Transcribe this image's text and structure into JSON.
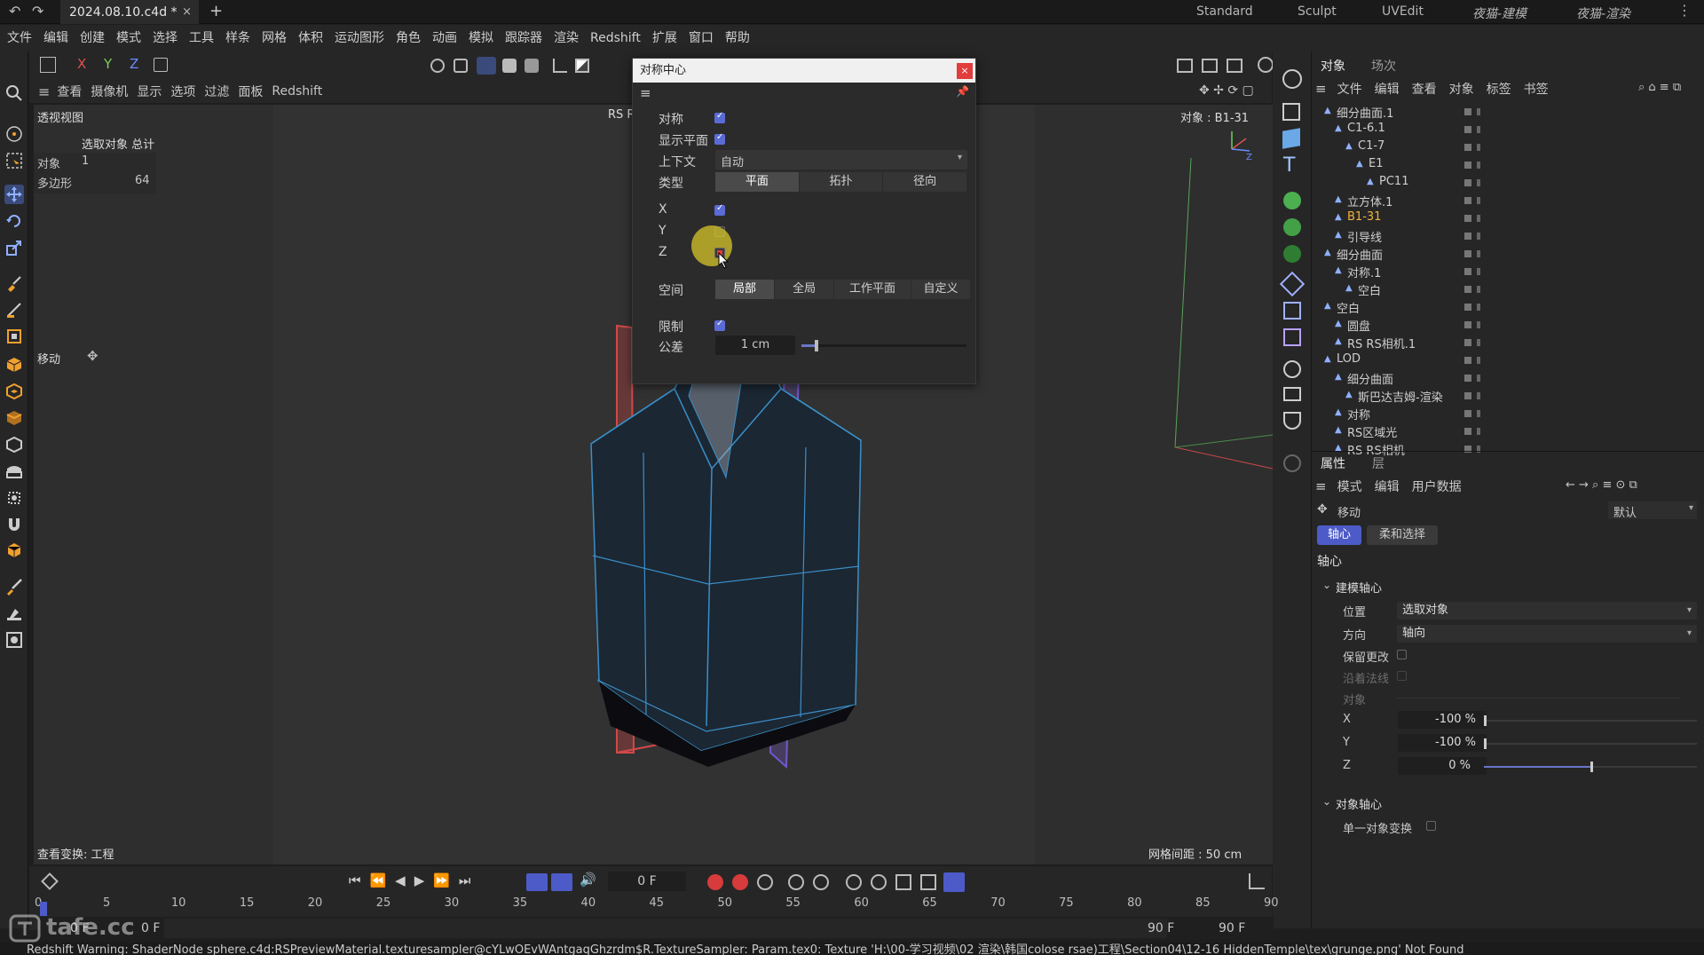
{
  "titlebar": {
    "file_tab": "2024.08.10.c4d *",
    "close": "×",
    "new_tab": "+",
    "workspaces": [
      "Standard",
      "Sculpt",
      "UVEdit",
      "夜猫-建模",
      "夜猫-渲染"
    ]
  },
  "menubar": [
    "文件",
    "编辑",
    "创建",
    "模式",
    "选择",
    "工具",
    "样条",
    "网格",
    "体积",
    "运动图形",
    "角色",
    "动画",
    "模拟",
    "跟踪器",
    "渲染",
    "Redshift",
    "扩展",
    "窗口",
    "帮助"
  ],
  "viewport": {
    "menu": [
      "查看",
      "摄像机",
      "显示",
      "选项",
      "过滤",
      "面板",
      "Redshift"
    ],
    "name": "透视视图",
    "stats_header": "选取对象 总计",
    "stats": [
      {
        "label": "对象",
        "value": "1"
      },
      {
        "label": "多边形",
        "value": "64"
      }
    ],
    "tool_label": "移动",
    "rs_label": "RS R",
    "object_label": "对象 : B1-31",
    "view_transform": "查看变换: 工程",
    "grid_spacing": "网格间距 : 50 cm"
  },
  "dialog": {
    "title": "对称中心",
    "close": "×",
    "symmetry_label": "对称",
    "show_plane_label": "显示平面",
    "context_label": "上下文",
    "context_value": "自动",
    "type_label": "类型",
    "type_options": [
      "平面",
      "拓扑",
      "径向"
    ],
    "x_label": "X",
    "y_label": "Y",
    "z_label": "Z",
    "space_label": "空间",
    "space_options": [
      "局部",
      "全局",
      "工作平面",
      "自定义"
    ],
    "limit_label": "限制",
    "tolerance_label": "公差",
    "tolerance_value": "1 cm",
    "tolerance_fraction": 0.08
  },
  "objects_panel": {
    "tabs": [
      "对象",
      "场次"
    ],
    "menu": [
      "文件",
      "编辑",
      "查看",
      "对象",
      "标签",
      "书签"
    ],
    "rows": [
      {
        "name": "细分曲面.1",
        "indent": 0
      },
      {
        "name": "C1-6.1",
        "indent": 1
      },
      {
        "name": "C1-7",
        "indent": 2
      },
      {
        "name": "E1",
        "indent": 3
      },
      {
        "name": "PC11",
        "indent": 4
      },
      {
        "name": "立方体.1",
        "indent": 1
      },
      {
        "name": "B1-31",
        "indent": 1,
        "selected": true
      },
      {
        "name": "引导线",
        "indent": 1
      },
      {
        "name": "细分曲面",
        "indent": 0
      },
      {
        "name": "对称.1",
        "indent": 1
      },
      {
        "name": "空白",
        "indent": 2
      },
      {
        "name": "空白",
        "indent": 0
      },
      {
        "name": "圆盘",
        "indent": 1
      },
      {
        "name": "RS RS相机.1",
        "indent": 1
      },
      {
        "name": "LOD",
        "indent": 0
      },
      {
        "name": "细分曲面",
        "indent": 1
      },
      {
        "name": "斯巴达吉姆-渲染",
        "indent": 2
      },
      {
        "name": "对称",
        "indent": 1
      },
      {
        "name": "RS区域光",
        "indent": 1
      },
      {
        "name": "RS RS相机",
        "indent": 1
      }
    ]
  },
  "attributes_panel": {
    "tabs": [
      "属性",
      "层"
    ],
    "menu": [
      "模式",
      "编辑",
      "用户数据"
    ],
    "tool_name": "移动",
    "preset": "默认",
    "subtabs": [
      "轴心",
      "柔和选择"
    ],
    "section": "轴心",
    "group_modeling": "建模轴心",
    "position_label": "位置",
    "position_value": "选取对象",
    "direction_label": "方向",
    "direction_value": "轴向",
    "keep_changes_label": "保留更改",
    "along_normal_label": "沿着法线",
    "object_label": "对象",
    "x_label": "X",
    "x_value": "-100 %",
    "y_label": "Y",
    "y_value": "-100 %",
    "z_label": "Z",
    "z_value": "0 %",
    "group_object": "对象轴心",
    "single_object_label": "单一对象变换"
  },
  "timeline": {
    "current_frame": "0 F",
    "ticks": [
      "0",
      "5",
      "10",
      "15",
      "20",
      "25",
      "30",
      "35",
      "40",
      "45",
      "50",
      "55",
      "60",
      "65",
      "70",
      "75",
      "80",
      "85",
      "90"
    ],
    "start_a": "0 F",
    "start_b": "0 F",
    "end_a": "90 F",
    "end_b": "90 F"
  },
  "watermark": "tafe.cc",
  "status": "Redshift Warning: ShaderNode sphere.c4d:RSPreviewMaterial.texturesampler@cYLwOEvWAntgaqGhzrdm$R.TextureSampler: Param.tex0: Texture 'H:\\00-学习视频\\02 渲染\\韩国colose rsae)工程\\Section04\\12-16 HiddenTemple\\tex\\grunge.png' Not Found",
  "colors": {
    "accent": "#5b6bd6",
    "selected_object": "#f0b43c",
    "close_red": "#e23c3c",
    "highlight": "#d7c52a"
  }
}
